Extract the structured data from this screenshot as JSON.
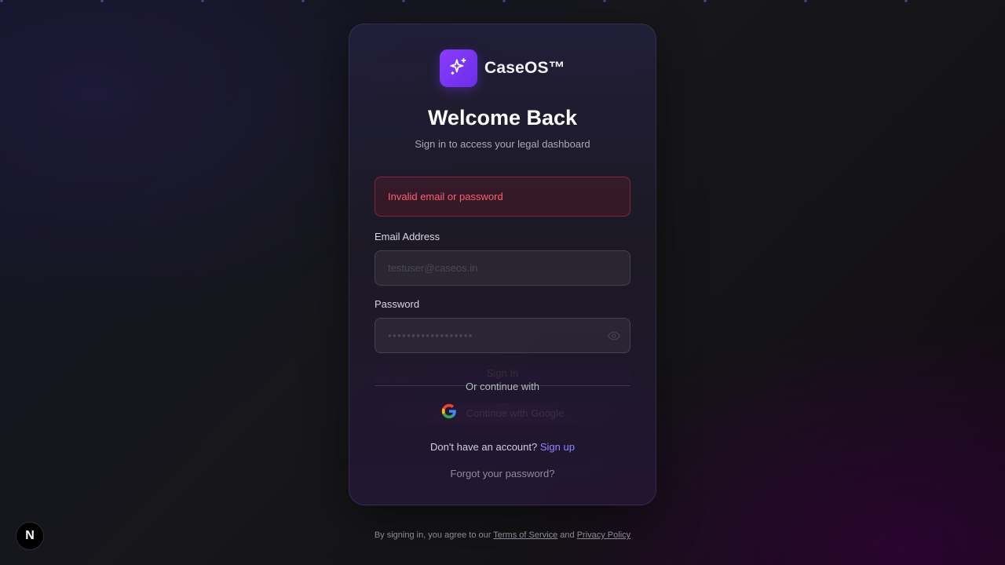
{
  "brand": {
    "name": "CaseOS™",
    "logo_icon": "sparkles-icon",
    "logo_color": "#7c3aed"
  },
  "header": {
    "title": "Welcome Back",
    "subtitle": "Sign in to access your legal dashboard"
  },
  "error": {
    "message": "Invalid email or password",
    "color": "#ff5f6d"
  },
  "form": {
    "email_label": "Email Address",
    "email_value": "testuser@caseos.in",
    "password_label": "Password",
    "password_value": "••••••••••••••••••",
    "submit_label": "Sign In"
  },
  "divider": {
    "text": "Or continue with"
  },
  "google": {
    "label": "Continue with Google",
    "icon": "google-icon"
  },
  "signup": {
    "prompt": "Don't have an account?",
    "link_label": "Sign up",
    "link_color": "#8a88ff"
  },
  "forgot": {
    "label": "Forgot your password?"
  },
  "footer": {
    "prefix": "By signing in, you agree to our",
    "terms_label": "Terms of Service",
    "conjunction": "and",
    "privacy_label": "Privacy Policy"
  },
  "dev_badge": {
    "letter": "N",
    "icon": "nextjs-icon"
  }
}
